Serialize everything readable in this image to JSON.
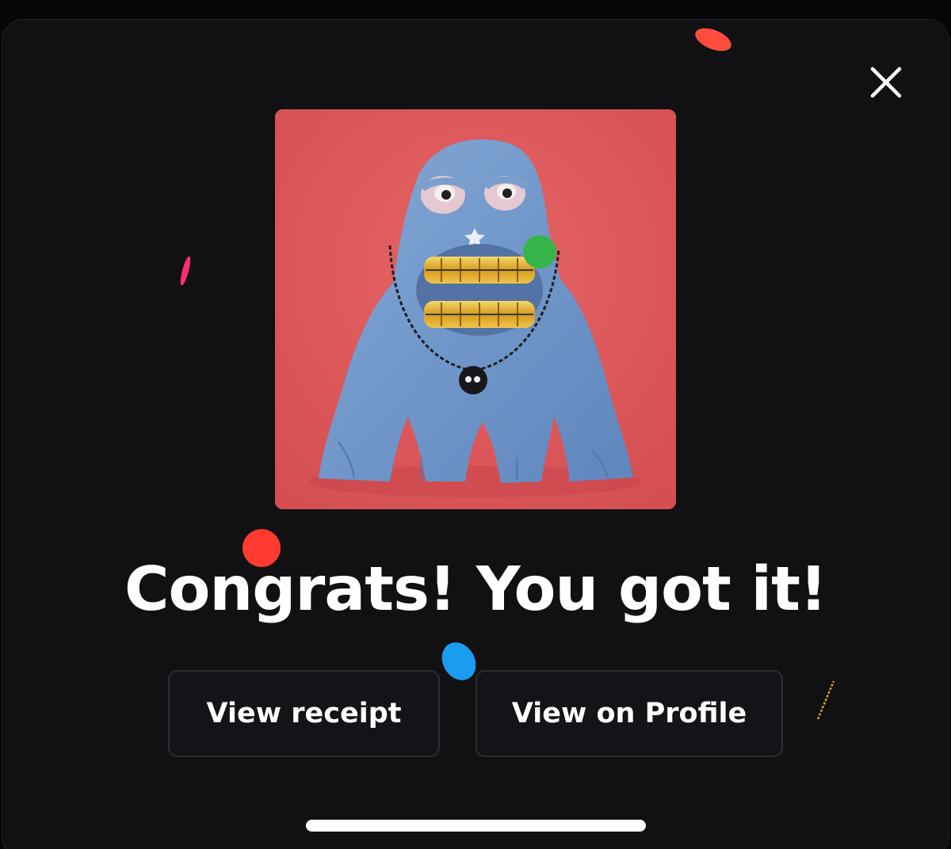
{
  "modal": {
    "headline": "Congrats! You got it!",
    "close_icon": "close-icon",
    "nft_image": "blue-clay-monster-with-gold-grills",
    "buttons": {
      "receipt_label": "View receipt",
      "profile_label": "View on Profile"
    }
  },
  "colors": {
    "background": "#111113",
    "card_background": "#e05a5c",
    "text": "#ffffff",
    "button_background": "#141418",
    "button_border": "#2c2c33"
  }
}
